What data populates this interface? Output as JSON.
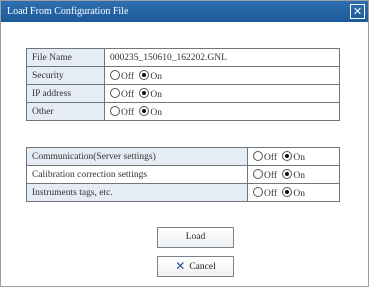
{
  "window": {
    "title": "Load From Configuration File",
    "close_glyph": "✕"
  },
  "top_table": {
    "rows": [
      {
        "label": "File Name",
        "value": "000235_150610_162202.GNL"
      },
      {
        "label": "Security",
        "off": "Off",
        "on": "On",
        "selected": "On"
      },
      {
        "label": "IP address",
        "off": "Off",
        "on": "On",
        "selected": "On"
      },
      {
        "label": "Other",
        "off": "Off",
        "on": "On",
        "selected": "On"
      }
    ]
  },
  "bottom_table": {
    "rows": [
      {
        "label": "Communication(Server settings)",
        "off": "Off",
        "on": "On",
        "selected": "On"
      },
      {
        "label": "Calibration correction settings",
        "off": "Off",
        "on": "On",
        "selected": "On"
      },
      {
        "label": "Instruments tags, etc.",
        "off": "Off",
        "on": "On",
        "selected": "On"
      }
    ]
  },
  "buttons": {
    "load": "Load",
    "cancel": "Cancel",
    "cancel_icon": "x-icon"
  }
}
